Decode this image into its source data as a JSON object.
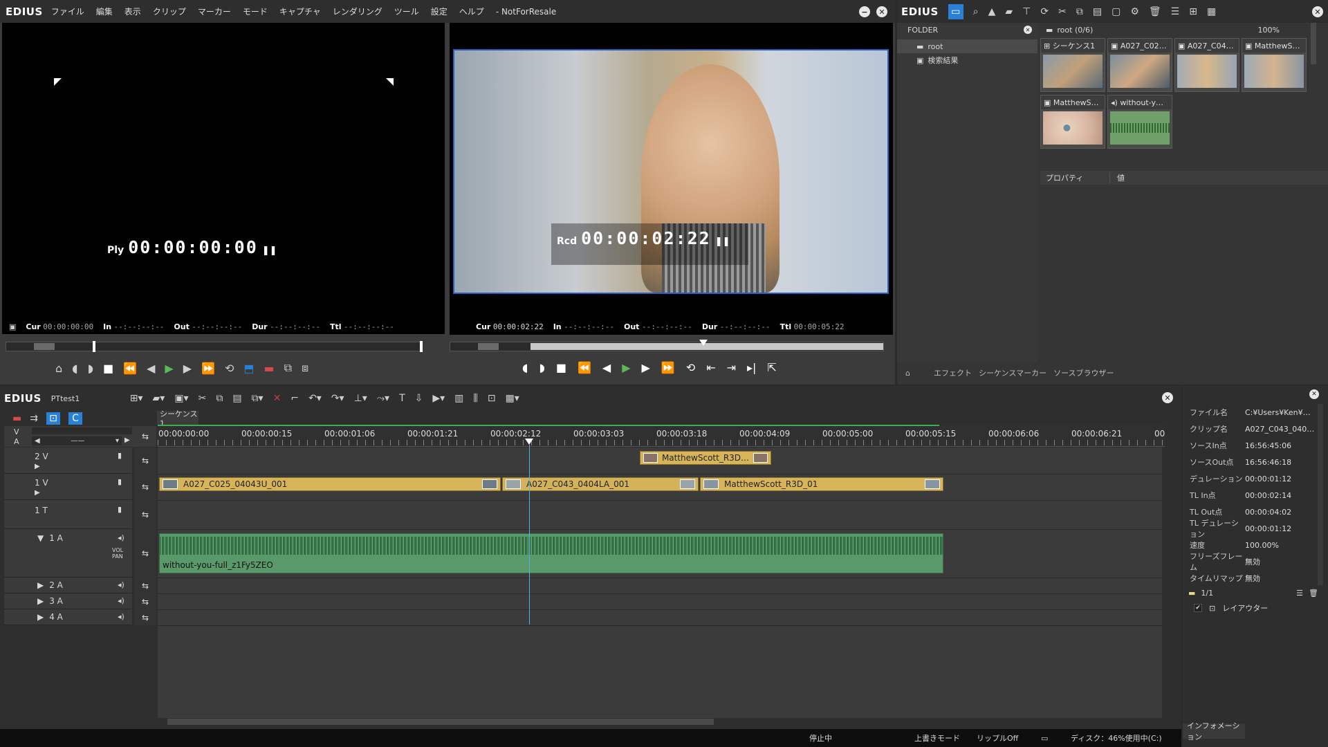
{
  "app": {
    "logo": "EDIUS",
    "title": "- NotForResale"
  },
  "menu": [
    "ファイル",
    "編集",
    "表示",
    "クリップ",
    "マーカー",
    "モード",
    "キャプチャ",
    "レンダリング",
    "ツール",
    "設定",
    "ヘルプ"
  ],
  "player": {
    "label": "Ply",
    "timecode": "00:00:00:00",
    "status": {
      "cur_label": "Cur",
      "cur": "00:00:00:00",
      "in_label": "In",
      "in": "--:--:--:--",
      "out_label": "Out",
      "out": "--:--:--:--",
      "dur_label": "Dur",
      "dur": "--:--:--:--",
      "ttl_label": "Ttl",
      "ttl": "--:--:--:--"
    }
  },
  "recorder": {
    "label": "Rcd",
    "timecode": "00:00:02:22",
    "status": {
      "cur_label": "Cur",
      "cur": "00:00:02:22",
      "in_label": "In",
      "in": "--:--:--:--",
      "out_label": "Out",
      "out": "--:--:--:--",
      "dur_label": "Dur",
      "dur": "--:--:--:--",
      "ttl_label": "Ttl",
      "ttl": "00:00:05:22"
    },
    "playhead_fraction": 0.49
  },
  "bin": {
    "logo": "EDIUS",
    "folder_header": "FOLDER",
    "folders": [
      "root",
      "検索結果"
    ],
    "path": "root (0/6)",
    "zoom": "100%",
    "clips": [
      {
        "name": "シーケンス1",
        "icon": "sequence-icon",
        "color": "#6a7a8a"
      },
      {
        "name": "A027_C02…",
        "icon": "video-clip-icon",
        "color": "#6e8290"
      },
      {
        "name": "A027_C04…",
        "icon": "video-clip-icon",
        "color": "#8a8e96"
      },
      {
        "name": "MatthewS…",
        "icon": "video-clip-icon",
        "color": "#7e8a98"
      },
      {
        "name": "MatthewS…",
        "icon": "video-clip-icon",
        "color": "#c9b7a8"
      },
      {
        "name": "without-y…",
        "icon": "audio-clip-icon",
        "color": "#6fa06a"
      }
    ],
    "prop_col": "プロパティ",
    "value_col": "値",
    "tabs": [
      "エフェクト",
      "シーケンスマーカー",
      "ソースブラウザー"
    ]
  },
  "timeline": {
    "logo": "EDIUS",
    "project": "PTtest1",
    "sequence_tab": "シーケンス1",
    "va_labels": [
      "V",
      "A"
    ],
    "ruler": [
      "00:00:00:00",
      "00:00:00:15",
      "00:00:01:06",
      "00:00:01:21",
      "00:00:02:12",
      "00:00:03:03",
      "00:00:03:18",
      "00:00:04:09",
      "00:00:05:00",
      "00:00:05:15",
      "00:00:06:06",
      "00:00:06:21",
      "00"
    ],
    "tracks": [
      {
        "name": "2 V"
      },
      {
        "name": "1 V"
      },
      {
        "name": "1 T"
      },
      {
        "name": "1 A"
      },
      {
        "name": "2 A"
      },
      {
        "name": "3 A"
      },
      {
        "name": "4 A"
      }
    ],
    "clips_2v": [
      "MatthewScott_R3D…"
    ],
    "clips_1v": [
      "A027_C025_04043U_001",
      "A027_C043_0404LA_001",
      "MatthewScott_R3D_01"
    ],
    "audio_clip": "without-you-full_z1Fy5ZEO",
    "vol_pan": "VOL PAN"
  },
  "status_bar": {
    "state": "停止中",
    "mode": "上書きモード",
    "ripple": "リップルOff",
    "disk": "ディスク：46%使用中(C:)"
  },
  "info": {
    "rows": [
      {
        "k": "ファイル名",
        "v": "C:¥Users¥Ken¥…"
      },
      {
        "k": "クリップ名",
        "v": "A027_C043_040…"
      },
      {
        "k": "ソースIn点",
        "v": "16:56:45:06"
      },
      {
        "k": "ソースOut点",
        "v": "16:56:46:18"
      },
      {
        "k": "デュレーション",
        "v": "00:00:01:12"
      },
      {
        "k": "TL In点",
        "v": "00:00:02:14"
      },
      {
        "k": "TL Out点",
        "v": "00:00:04:02"
      },
      {
        "k": "TL デュレーション",
        "v": "00:00:01:12"
      },
      {
        "k": "速度",
        "v": "100.00%"
      },
      {
        "k": "フリーズフレーム",
        "v": "無効"
      },
      {
        "k": "タイムリマップ",
        "v": "無効"
      }
    ],
    "page": "1/1",
    "layouter": "レイアウター",
    "tab": "インフォメーション"
  },
  "colors": {
    "clip_video": "#d8b458",
    "clip_audio": "#5a9a6a",
    "accent_blue": "#2a7fd8",
    "play_green": "#5bb85b"
  }
}
